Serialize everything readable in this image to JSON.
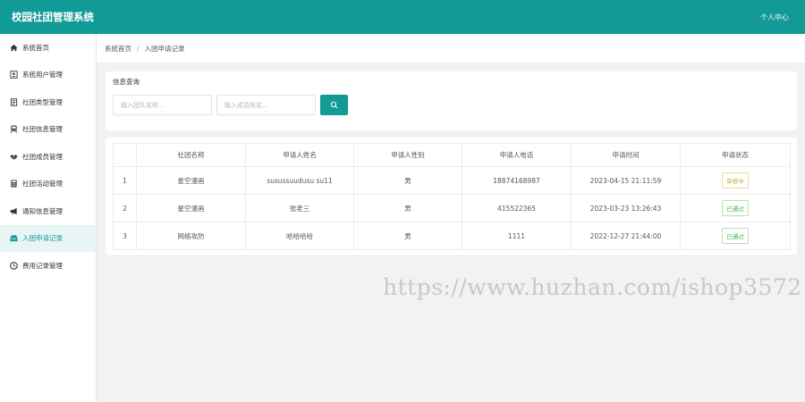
{
  "header": {
    "app_title": "校园社团管理系统",
    "user_center": "个人中心"
  },
  "sidebar": {
    "items": [
      {
        "label": "系统首页",
        "icon": "home-icon",
        "active": false
      },
      {
        "label": "系统用户管理",
        "icon": "user-card-icon",
        "active": false
      },
      {
        "label": "社团类型管理",
        "icon": "document-icon",
        "active": false
      },
      {
        "label": "社团信息管理",
        "icon": "train-icon",
        "active": false
      },
      {
        "label": "社团成员管理",
        "icon": "handshake-icon",
        "active": false
      },
      {
        "label": "社团活动管理",
        "icon": "calculator-icon",
        "active": false
      },
      {
        "label": "通知信息管理",
        "icon": "bullhorn-icon",
        "active": false
      },
      {
        "label": "入团申请记录",
        "icon": "inbox-icon",
        "active": true
      },
      {
        "label": "费用记录管理",
        "icon": "clock-icon",
        "active": false
      }
    ]
  },
  "breadcrumb": {
    "home": "系统首页",
    "separator": "/",
    "current": "入团申请记录"
  },
  "query": {
    "title": "信息查询",
    "club_placeholder": "输入团队名称...",
    "applicant_placeholder": "输入成员姓名...",
    "club_value": "",
    "applicant_value": ""
  },
  "table": {
    "headers": [
      "",
      "社团名称",
      "申请人姓名",
      "申请人性别",
      "申请人电话",
      "申请时间",
      "申请状态"
    ],
    "rows": [
      {
        "idx": "1",
        "club": "星空漫画",
        "name": "susussuudusu su11",
        "gender": "男",
        "phone": "18874168987",
        "time": "2023-04-15 21:11:59",
        "status": "审核中",
        "status_type": "pending"
      },
      {
        "idx": "2",
        "club": "星空漫画",
        "name": "张老三",
        "gender": "男",
        "phone": "415522365",
        "time": "2023-03-23 13:26:43",
        "status": "已通过",
        "status_type": "passed"
      },
      {
        "idx": "3",
        "club": "网络攻防",
        "name": "哈哈哈哈",
        "gender": "男",
        "phone": "1111",
        "time": "2022-12-27 21:44:00",
        "status": "已通过",
        "status_type": "passed"
      }
    ]
  },
  "watermark": "https://www.huzhan.com/ishop3572",
  "colors": {
    "primary": "#129a96",
    "pending": "#d4a23c",
    "passed": "#46b347"
  }
}
